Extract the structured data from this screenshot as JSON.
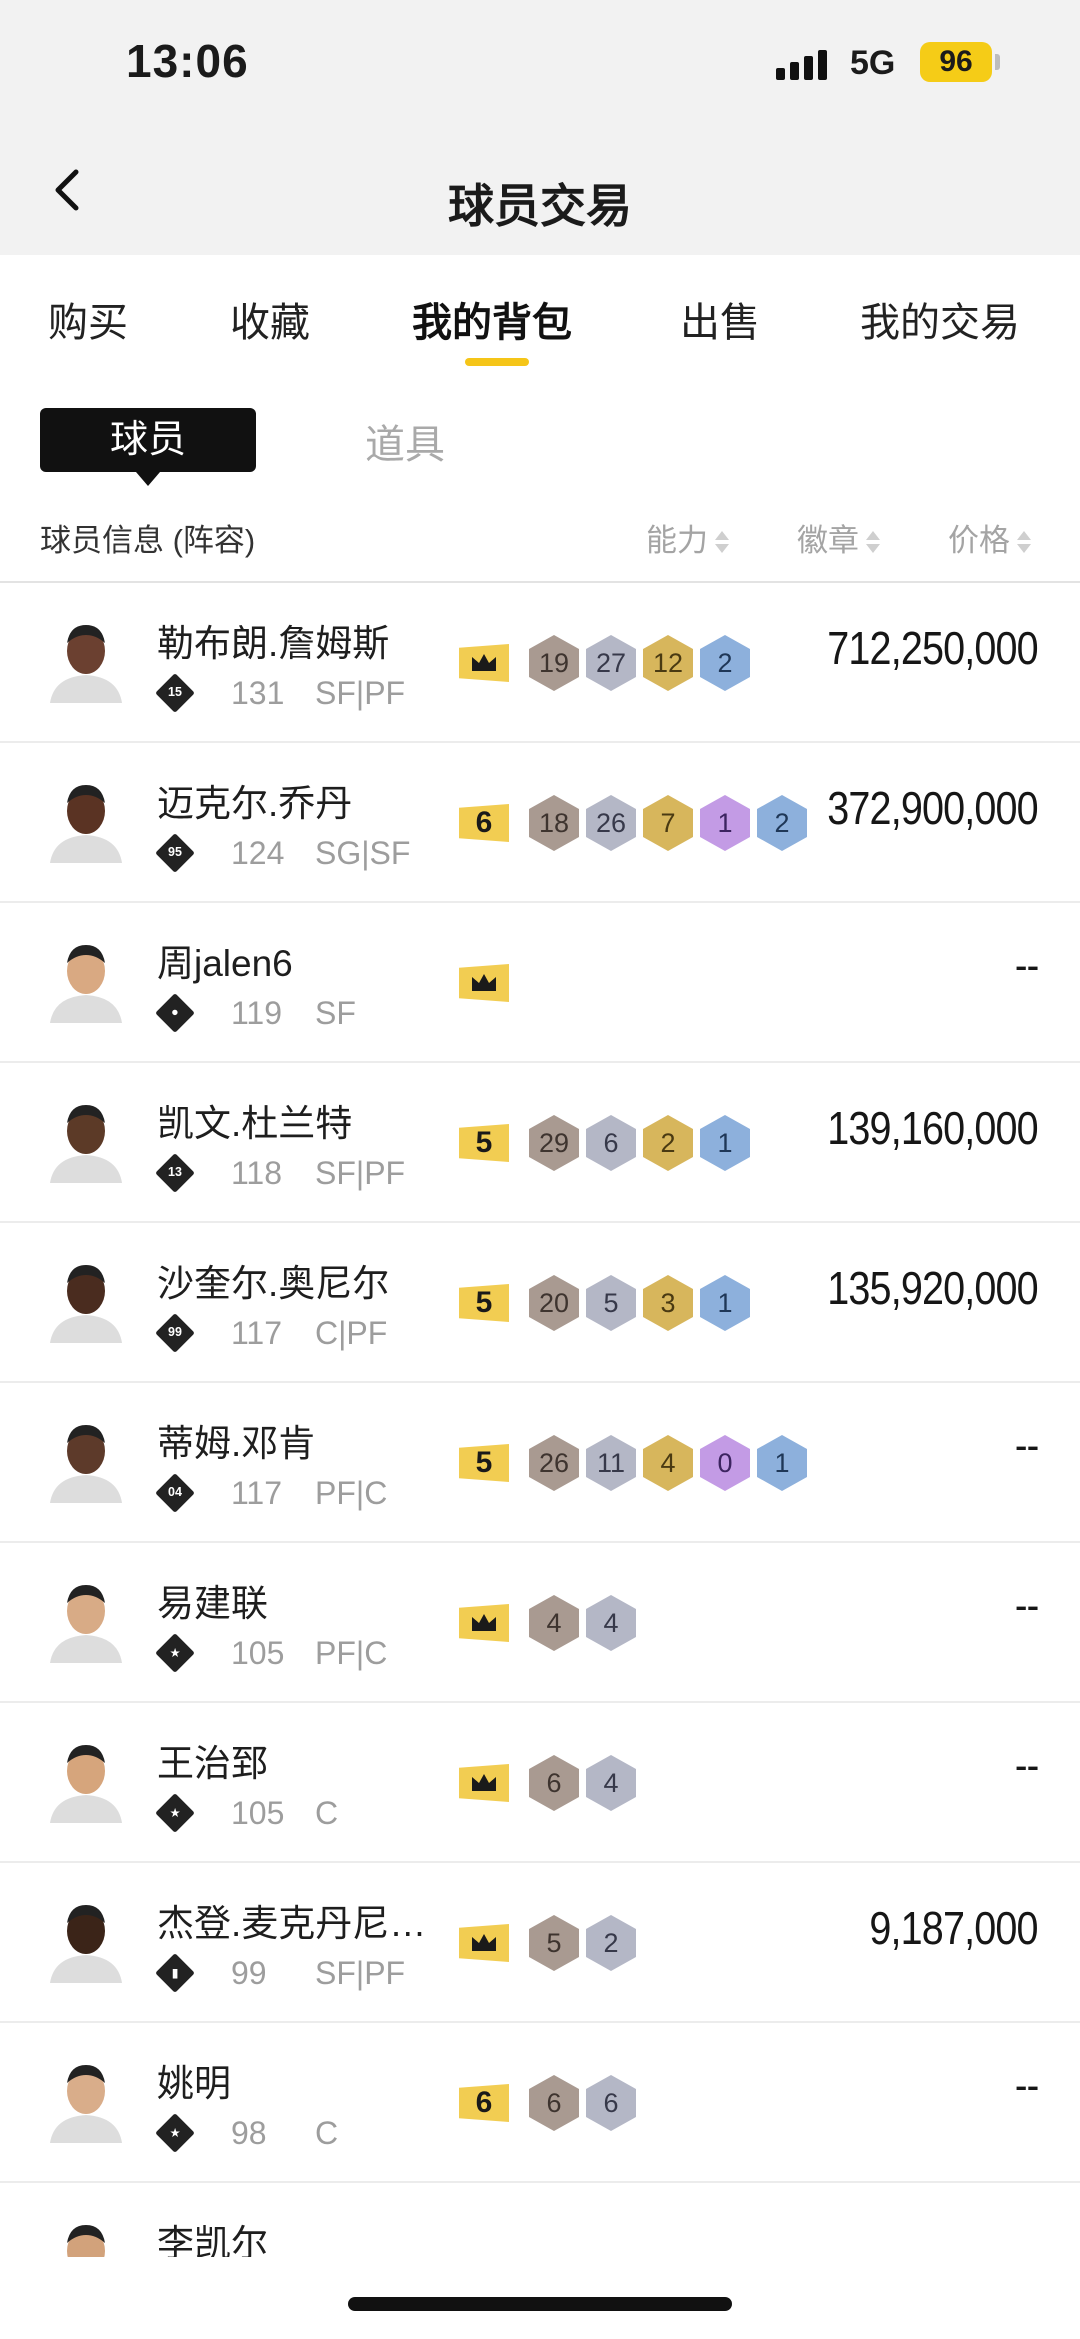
{
  "status_bar": {
    "time": "13:06",
    "network": "5G",
    "battery": "96"
  },
  "header": {
    "title": "球员交易"
  },
  "tabs": [
    {
      "label": "购买"
    },
    {
      "label": "收藏"
    },
    {
      "label": "我的背包",
      "active": true
    },
    {
      "label": "出售"
    },
    {
      "label": "我的交易"
    }
  ],
  "sub_tabs": {
    "players": "球员",
    "props": "道具"
  },
  "columns": {
    "info": "球员信息 (阵容)",
    "ability": "能力",
    "badge": "徽章",
    "price": "价格"
  },
  "colors": {
    "accent": "#f5c518",
    "tag": "#f2cd52",
    "bronze": "#a99a91",
    "silver": "#b4b7c6",
    "gold": "#d7b65c",
    "purple": "#c39be5",
    "blue": "#8db0dc"
  },
  "players": [
    {
      "name": "勒布朗.詹姆斯",
      "rank": "15",
      "ovr": "131",
      "pos": "SF|PF",
      "tag": "crown",
      "badges": [
        [
          "bronze",
          "19"
        ],
        [
          "silver",
          "27"
        ],
        [
          "gold",
          "12"
        ],
        [
          "blue",
          "2"
        ]
      ],
      "price": "712,250,000"
    },
    {
      "name": "迈克尔.乔丹",
      "rank": "95",
      "ovr": "124",
      "pos": "SG|SF",
      "tag": "6",
      "badges": [
        [
          "bronze",
          "18"
        ],
        [
          "silver",
          "26"
        ],
        [
          "gold",
          "7"
        ],
        [
          "purple",
          "1"
        ],
        [
          "blue",
          "2"
        ]
      ],
      "price": "372,900,000"
    },
    {
      "name": "周jalen6",
      "rank": "person-icon",
      "ovr": "119",
      "pos": "SF",
      "tag": "crown",
      "badges": [],
      "price": "--"
    },
    {
      "name": "凯文.杜兰特",
      "rank": "13",
      "ovr": "118",
      "pos": "SF|PF",
      "tag": "5",
      "badges": [
        [
          "bronze",
          "29"
        ],
        [
          "silver",
          "6"
        ],
        [
          "gold",
          "2"
        ],
        [
          "blue",
          "1"
        ]
      ],
      "price": "139,160,000"
    },
    {
      "name": "沙奎尔.奥尼尔",
      "rank": "99",
      "ovr": "117",
      "pos": "C|PF",
      "tag": "5",
      "badges": [
        [
          "bronze",
          "20"
        ],
        [
          "silver",
          "5"
        ],
        [
          "gold",
          "3"
        ],
        [
          "blue",
          "1"
        ]
      ],
      "price": "135,920,000"
    },
    {
      "name": "蒂姆.邓肯",
      "rank": "04",
      "ovr": "117",
      "pos": "PF|C",
      "tag": "5",
      "badges": [
        [
          "bronze",
          "26"
        ],
        [
          "silver",
          "11"
        ],
        [
          "gold",
          "4"
        ],
        [
          "purple",
          "0"
        ],
        [
          "blue",
          "1"
        ]
      ],
      "price": "--"
    },
    {
      "name": "易建联",
      "rank": "star-icon",
      "ovr": "105",
      "pos": "PF|C",
      "tag": "crown",
      "badges": [
        [
          "bronze",
          "4"
        ],
        [
          "silver",
          "4"
        ]
      ],
      "price": "--"
    },
    {
      "name": "王治郅",
      "rank": "star-icon",
      "ovr": "105",
      "pos": "C",
      "tag": "crown",
      "badges": [
        [
          "bronze",
          "6"
        ],
        [
          "silver",
          "4"
        ]
      ],
      "price": "--"
    },
    {
      "name": "杰登.麦克丹尼…",
      "rank": "bars-icon",
      "ovr": "99",
      "pos": "SF|PF",
      "tag": "crown",
      "badges": [
        [
          "bronze",
          "5"
        ],
        [
          "silver",
          "2"
        ]
      ],
      "price": "9,187,000"
    },
    {
      "name": "姚明",
      "rank": "star-icon",
      "ovr": "98",
      "pos": "C",
      "tag": "6",
      "badges": [
        [
          "bronze",
          "6"
        ],
        [
          "silver",
          "6"
        ]
      ],
      "price": "--"
    },
    {
      "name": "李凯尔",
      "rank": "",
      "ovr": "",
      "pos": "",
      "tag": "",
      "badges": [],
      "price": ""
    }
  ]
}
